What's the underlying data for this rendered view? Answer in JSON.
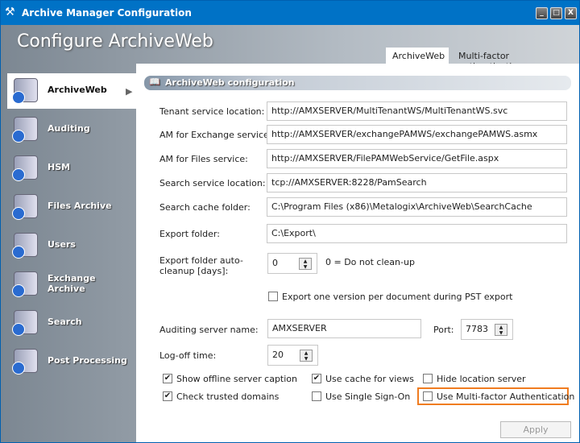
{
  "window": {
    "title": "Archive Manager Configuration",
    "minimize": "_",
    "maximize": "□",
    "close": "X"
  },
  "header": {
    "title": "Configure ArchiveWeb"
  },
  "tabs": [
    {
      "label": "ArchiveWeb"
    },
    {
      "label": "Multi-factor authentication"
    }
  ],
  "sidebar": {
    "items": [
      {
        "label": "ArchiveWeb"
      },
      {
        "label": "Auditing"
      },
      {
        "label": "HSM"
      },
      {
        "label": "Files Archive"
      },
      {
        "label": "Users"
      },
      {
        "label": "Exchange Archive"
      },
      {
        "label": "Search"
      },
      {
        "label": "Post Processing"
      }
    ]
  },
  "section": {
    "title": "ArchiveWeb configuration"
  },
  "fields": [
    {
      "label": "Tenant service location:",
      "value": "http://AMXSERVER/MultiTenantWS/MultiTenantWS.svc"
    },
    {
      "label": "AM for Exchange service:",
      "value": "http://AMXSERVER/exchangePAMWS/exchangePAMWS.asmx"
    },
    {
      "label": "AM for Files service:",
      "value": "http://AMXSERVER/FilePAMWebService/GetFile.aspx"
    },
    {
      "label": "Search service location:",
      "value": "tcp://AMXSERVER:8228/PamSearch"
    },
    {
      "label": "Search cache folder:",
      "value": "C:\\Program Files (x86)\\Metalogix\\ArchiveWeb\\SearchCache"
    },
    {
      "label": "Export folder:",
      "value": "C:\\Export\\"
    }
  ],
  "cleanup": {
    "label": "Export folder auto-cleanup [days]:",
    "value": "0",
    "hint": "0 = Do not clean-up"
  },
  "export_one_version": {
    "label": "Export one version per document during PST export",
    "checked": false
  },
  "auditing": {
    "label": "Auditing server name:",
    "value": "AMXSERVER",
    "port_label": "Port:",
    "port": "7783"
  },
  "logoff": {
    "label": "Log-off time:",
    "value": "20"
  },
  "checkboxes": [
    {
      "label": "Show offline server caption",
      "checked": true,
      "mark": "✔"
    },
    {
      "label": "Use cache for views",
      "checked": true,
      "mark": "✔"
    },
    {
      "label": "Hide location server",
      "checked": false,
      "mark": ""
    },
    {
      "label": "Check trusted domains",
      "checked": true,
      "mark": "✔"
    },
    {
      "label": "Use Single Sign-On",
      "checked": false,
      "mark": ""
    },
    {
      "label": "Use Multi-factor Authentication",
      "checked": false,
      "mark": ""
    }
  ],
  "apply_label": "Apply",
  "colors": {
    "titlebar": "#0072c6",
    "highlight": "#f07c20"
  }
}
